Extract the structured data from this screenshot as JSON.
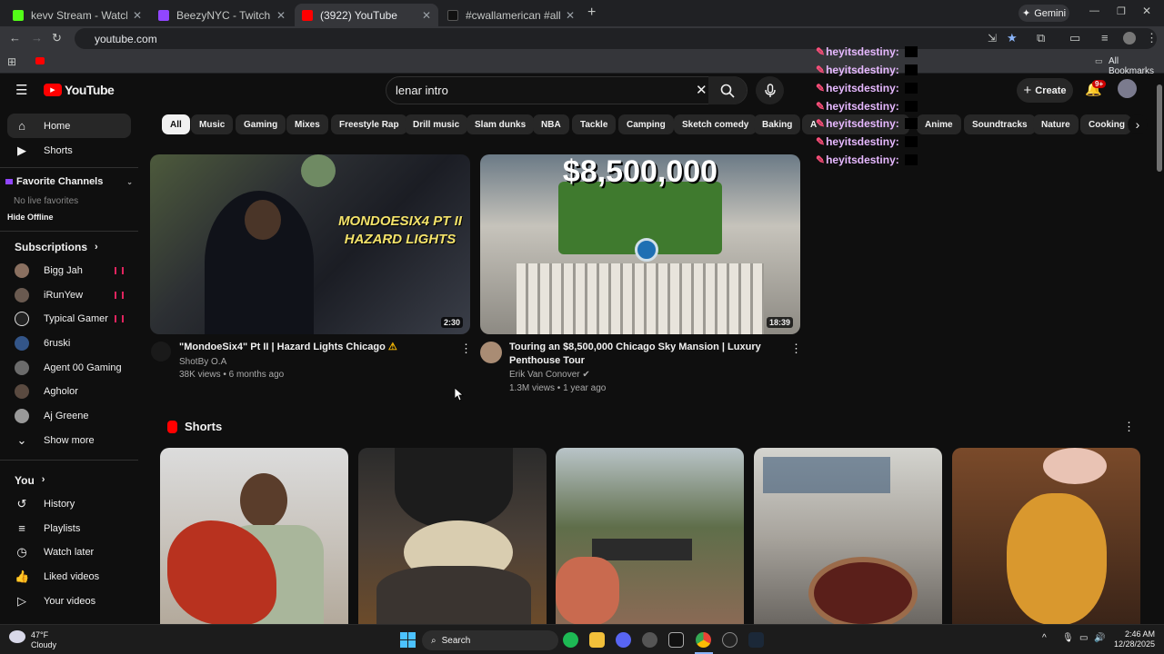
{
  "browser": {
    "tabs": [
      {
        "title": "kevv Stream - Watch Live on Kick",
        "color": "#53fc18"
      },
      {
        "title": "BeezyNYC - Twitch",
        "color": "#9146ff"
      },
      {
        "title": "(3922) YouTube",
        "color": "#ff0000"
      },
      {
        "title": "#cwallamerican #allamerican | ...",
        "color": "#111111"
      }
    ],
    "new_tab": "+",
    "gemini": "Gemini",
    "url": "youtube.com",
    "all_bookmarks": "All Bookmarks"
  },
  "yt": {
    "logo": "YouTube",
    "search_value": "lenar intro",
    "create": "Create",
    "notif_badge": "9+"
  },
  "sidebar": {
    "home": "Home",
    "shorts": "Shorts",
    "fav_channels": "Favorite Channels",
    "no_live": "No live favorites",
    "hide_offline": "Hide Offline",
    "subscriptions": "Subscriptions",
    "subs": [
      {
        "name": "Bigg Jah",
        "live": true
      },
      {
        "name": "iRunYew",
        "live": true
      },
      {
        "name": "Typical Gamer",
        "live": true
      },
      {
        "name": "6ruski",
        "live": false
      },
      {
        "name": "Agent 00 Gaming",
        "live": false
      },
      {
        "name": "Agholor",
        "live": false
      },
      {
        "name": "Aj Greene",
        "live": false
      }
    ],
    "show_more": "Show more",
    "you": "You",
    "history": "History",
    "playlists": "Playlists",
    "watch_later": "Watch later",
    "liked": "Liked videos",
    "your_videos": "Your videos"
  },
  "chips": [
    "All",
    "Music",
    "Gaming",
    "Mixes",
    "Freestyle Rap",
    "Drill music",
    "Slam dunks",
    "NBA",
    "Tackle",
    "Camping",
    "Sketch comedy",
    "Baking",
    "A",
    "Anime",
    "Soundtracks",
    "Nature",
    "Cooking sh"
  ],
  "videos": [
    {
      "title": "\"MondoeSix4\" Pt II | Hazard Lights Chicago",
      "channel": "ShotBy O.A",
      "meta": "38K views • 6 months ago",
      "duration": "2:30",
      "thumb_text": "MONDOESIX4 PT II HAZARD LIGHTS"
    },
    {
      "title_l1": "Touring an $8,500,000 Chicago Sky Mansion | Luxury",
      "title_l2": "Penthouse Tour",
      "channel": "Erik Van Conover",
      "meta": "1.3M views • 1 year ago",
      "duration": "18:39",
      "thumb_text": "$8,500,000"
    }
  ],
  "shorts_title": "Shorts",
  "chat": {
    "user": "heyitsdestiny:",
    "rows": 7
  },
  "taskbar": {
    "temp": "47°F",
    "weather": "Cloudy",
    "search": "Search",
    "time": "2:46 AM",
    "date": "12/28/2025"
  }
}
